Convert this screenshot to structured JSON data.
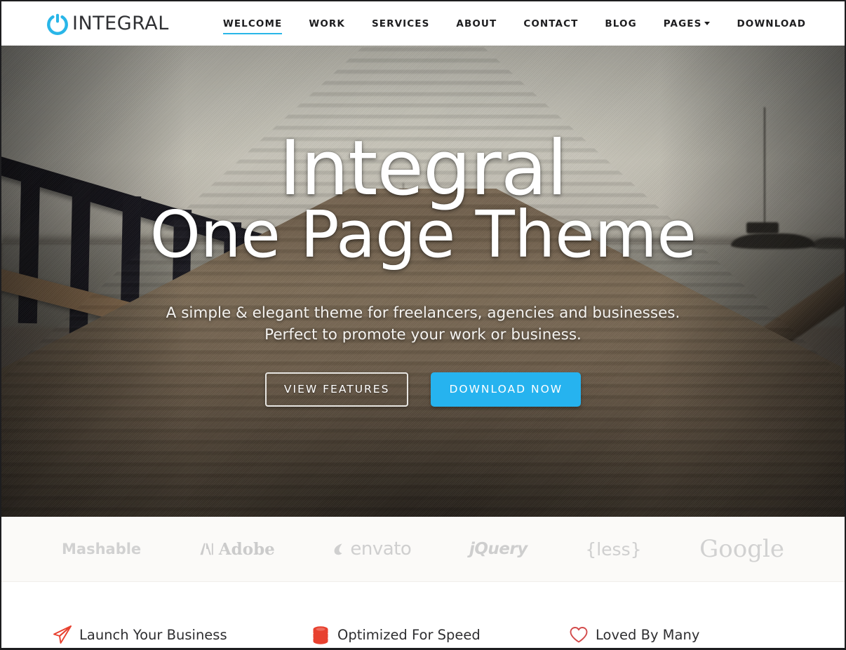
{
  "brand": {
    "icon": "power-icon",
    "name": "INTEGRAL",
    "accent": "#29b6e8"
  },
  "nav": {
    "items": [
      {
        "label": "WELCOME",
        "active": true,
        "dropdown": false
      },
      {
        "label": "WORK",
        "active": false,
        "dropdown": false
      },
      {
        "label": "SERVICES",
        "active": false,
        "dropdown": false
      },
      {
        "label": "ABOUT",
        "active": false,
        "dropdown": false
      },
      {
        "label": "CONTACT",
        "active": false,
        "dropdown": false
      },
      {
        "label": "BLOG",
        "active": false,
        "dropdown": false
      },
      {
        "label": "PAGES",
        "active": false,
        "dropdown": true
      },
      {
        "label": "DOWNLOAD",
        "active": false,
        "dropdown": false
      }
    ]
  },
  "hero": {
    "title_line1": "Integral",
    "title_line2": "One Page Theme",
    "subtitle_line1": "A simple & elegant theme for freelancers, agencies and businesses.",
    "subtitle_line2": "Perfect to promote your work or business.",
    "primary_button": "DOWNLOAD NOW",
    "secondary_button": "VIEW FEATURES",
    "primary_button_color": "#26b3ef",
    "background_description": "wooden pier deck leading to water with sailboats"
  },
  "clients": {
    "items": [
      {
        "name": "Mashable",
        "mark": "none"
      },
      {
        "name": "Adobe",
        "mark": "adobe-a-icon"
      },
      {
        "name": "envato",
        "mark": "envato-leaf-icon"
      },
      {
        "name": "jQuery",
        "mark": "none"
      },
      {
        "name": "{less}",
        "mark": "none"
      },
      {
        "name": "Google",
        "mark": "none"
      }
    ]
  },
  "features": {
    "items": [
      {
        "label": "Launch Your Business",
        "icon": "paper-plane-icon",
        "color": "#e8412f"
      },
      {
        "label": "Optimized For Speed",
        "icon": "database-icon",
        "color": "#e8412f"
      },
      {
        "label": "Loved By Many",
        "icon": "heart-icon",
        "color": "#d34a4a"
      }
    ]
  }
}
